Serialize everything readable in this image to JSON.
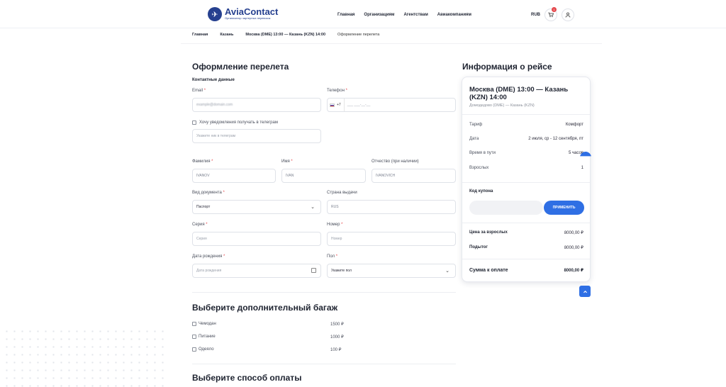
{
  "header": {
    "logo_name": "AviaContact",
    "logo_tagline": "Организатор чартерных перевозок",
    "nav": [
      "Главная",
      "Организациям",
      "Агентствам",
      "Авиакомпаниям"
    ],
    "currency": "RUB",
    "cart_count": "1",
    "cart_icon": "cart-icon",
    "user_icon": "user-icon"
  },
  "breadcrumbs": [
    "Главная",
    "Казань",
    "Москва (DME) 13:00 — Казань (KZN) 14:00",
    "Оформление перелета"
  ],
  "form": {
    "title": "Оформление перелета",
    "contact_section": "Контактные данные",
    "email_label": "Email",
    "email_placeholder": "example@domain.com",
    "phone_label": "Телефон",
    "phone_prefix": "+7",
    "phone_placeholder": "___ ___-__-__",
    "telegram_checkbox": "Хочу уведомления получать в телеграм",
    "telegram_placeholder": "Укажите ник в телеграм",
    "surname_label": "Фамилия",
    "surname_value": "IVANOV",
    "name_label": "Имя",
    "name_value": "IVAN",
    "patronymic_label": "Отчество (при наличии)",
    "patronymic_value": "IVANOVICH",
    "doc_type_label": "Вид документа",
    "doc_type_value": "Паспорт",
    "country_label": "Страна выдачи",
    "country_value": "RUS",
    "series_label": "Серия",
    "series_placeholder": "Серия",
    "number_label": "Номер",
    "number_placeholder": "Номер",
    "birthdate_label": "Дата рождения",
    "birthdate_placeholder": "Дата рождения",
    "gender_label": "Пол",
    "gender_placeholder": "Укажите пол",
    "required_mark": "*"
  },
  "baggage": {
    "title": "Выберите дополнительный багаж",
    "items": [
      {
        "label": "Чемодан",
        "price": "1500 ₽"
      },
      {
        "label": "Питание",
        "price": "1000 ₽"
      },
      {
        "label": "Одеяло",
        "price": "100 ₽"
      }
    ]
  },
  "payment": {
    "title": "Выберите способ оплаты"
  },
  "flight": {
    "section_title": "Информация о рейсе",
    "title": "Москва (DME) 13:00 — Казань (KZN) 14:00",
    "route": "Домодедово (DME) — Казань (KZN)",
    "rows": [
      {
        "k": "Тариф",
        "v": "Комфорт"
      },
      {
        "k": "Дата",
        "v": "2 июля, ср - 12 сентября, пт"
      },
      {
        "k": "Время в пути",
        "v": "5 часов"
      },
      {
        "k": "Взрослых",
        "v": "1"
      }
    ],
    "coupon_label": "Код купона",
    "coupon_button": "ПРИМЕНИТЬ",
    "adult_price_label": "Цена за взрослых",
    "adult_price_value": "8000,00 ₽",
    "subtotal_label": "Подытог",
    "subtotal_value": "8000,00 ₽",
    "total_label": "Сумма к оплате",
    "total_value": "8000,00 ₽"
  },
  "colors": {
    "accent": "#2f6fe4",
    "brand": "#26408f",
    "required": "#e5484d"
  }
}
